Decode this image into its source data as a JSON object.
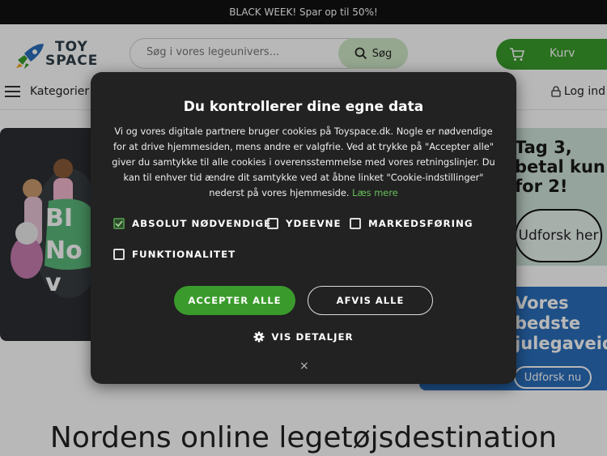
{
  "topbar": {
    "text": "BLACK WEEK! Spar op til 50%!"
  },
  "logo": {
    "line1": "TOY",
    "line2": "SPACE"
  },
  "search": {
    "placeholder": "Søg i vores legeunivers...",
    "button_label": "Søg"
  },
  "cart": {
    "label": "Kurv"
  },
  "nav": {
    "categories_label": "Kategorier",
    "login_label": "Log ind"
  },
  "hero": {
    "left_banner_text": "BI Nov"
  },
  "promo1": {
    "text": "Tag 3, betal kun for 2!",
    "button": "Udforsk her"
  },
  "promo2": {
    "text": "Vores bedste julegaveid",
    "button": "Udforsk nu"
  },
  "headline": "Nordens online legetøjsdestination",
  "cookie_modal": {
    "title": "Du kontrollerer dine egne data",
    "body": "Vi og vores digitale partnere bruger cookies på Toyspace.dk. Nogle er nødvendige for at drive hjemmesiden, mens andre er valgfrie. Ved at trykke på \"Accepter alle\" giver du samtykke til alle cookies i overensstemmelse med vores retningslinjer. Du kan til enhver tid ændre dit samtykke ved at åbne linket \"Cookie-indstillinger\" nederst på vores hjemmeside.",
    "read_more": "Læs mere",
    "checkboxes": [
      {
        "label": "ABSOLUT NØDVENDIGE",
        "checked": true
      },
      {
        "label": "YDEEVNE",
        "checked": false
      },
      {
        "label": "MARKEDSFØRING",
        "checked": false
      },
      {
        "label": "FUNKTIONALITET",
        "checked": false
      }
    ],
    "accept_all": "ACCEPTER ALLE",
    "reject_all": "AFVIS ALLE",
    "show_details": "VIS DETALJER",
    "close": "×"
  },
  "colors": {
    "brand_green": "#3a9b2c",
    "modal_bg": "#222222",
    "topbar_bg": "#111111",
    "promo_blue": "#2a6ebb"
  }
}
